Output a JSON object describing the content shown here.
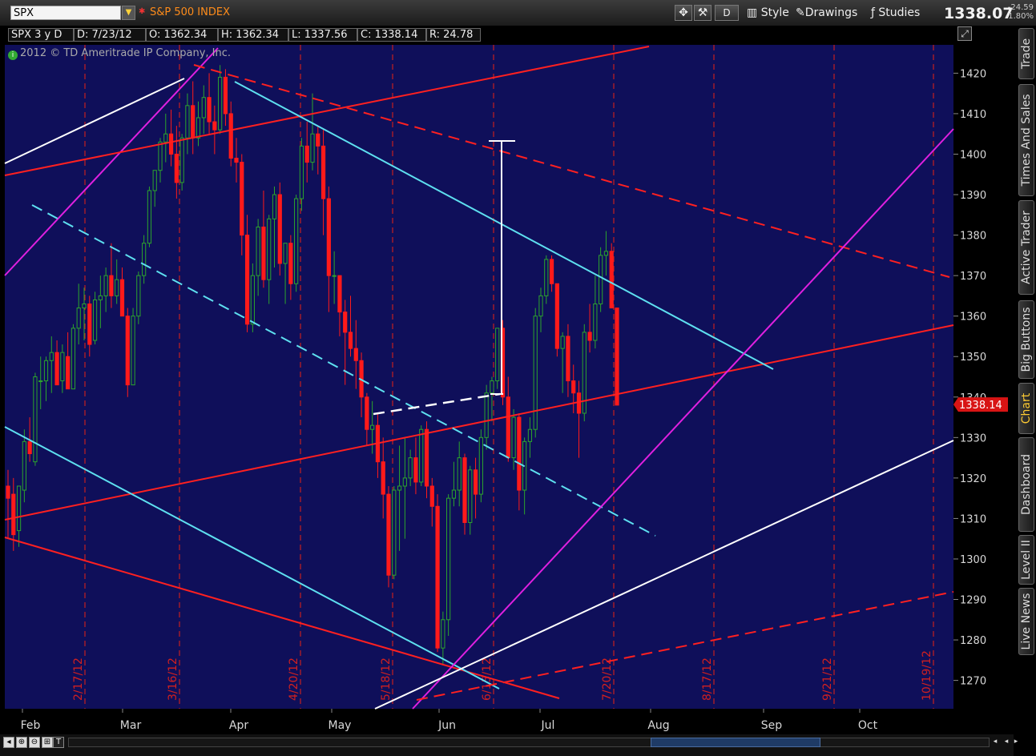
{
  "header": {
    "symbol": "SPX",
    "index_name": "S&P 500 INDEX",
    "period_button": "D",
    "style_label": "Style",
    "drawings_label": "Drawings",
    "studies_label": "Studies",
    "last_price": "1338.07",
    "net_change": "-24.59",
    "pct_change": "-1.80%"
  },
  "infobar": {
    "chart_id": "SPX 3 y D",
    "date": "D: 7/23/12",
    "open": "O: 1362.34",
    "high": "H: 1362.34",
    "low": "L: 1337.56",
    "close": "C: 1338.14",
    "range": "R: 24.78"
  },
  "copyright": "2012 © TD Ameritrade IP Company, Inc.",
  "side_tabs": [
    "Trade",
    "Times And Sales",
    "Active Trader",
    "Big Buttons",
    "Chart",
    "Dashboard",
    "Level II",
    "Live News"
  ],
  "icons": [
    "symbol-dropdown-icon",
    "crosshair-icon",
    "wrench-icon",
    "style-icon",
    "drawings-icon",
    "studies-icon",
    "resize-icon",
    "zoom-icon",
    "text-icon",
    "scroll-left-icon",
    "scroll-right-icon"
  ],
  "colors": {
    "background": "#0f0f5a",
    "up_candle": "#2ca52c",
    "down_candle": "#ff1a1a",
    "price_tag": "#d81414",
    "trendline_red": "#ff2020",
    "trendline_cyan": "#5ee0f0",
    "trendline_magenta": "#e020e0",
    "trendline_white": "#ffffff"
  },
  "chart_data": {
    "type": "candlestick",
    "title": "S&P 500 INDEX",
    "x_labels": [
      "Feb",
      "Mar",
      "Apr",
      "May",
      "Jun",
      "Jul",
      "Aug",
      "Sep",
      "Oct"
    ],
    "y_ticks": [
      1270,
      1280,
      1290,
      1300,
      1310,
      1320,
      1330,
      1340,
      1350,
      1360,
      1370,
      1380,
      1390,
      1400,
      1410,
      1420
    ],
    "ylim": [
      1263,
      1427
    ],
    "grid": false,
    "last_close_tag": "1338.14",
    "event_markers": [
      "2/17/12",
      "3/16/12",
      "4/20/12",
      "5/18/12",
      "6/15/12",
      "7/20/12",
      "8/17/12",
      "9/21/12",
      "10/19/12"
    ],
    "candles": [
      {
        "o": 1318,
        "h": 1322,
        "l": 1305,
        "c": 1315
      },
      {
        "o": 1316,
        "h": 1320,
        "l": 1302,
        "c": 1306
      },
      {
        "o": 1307,
        "h": 1318,
        "l": 1303,
        "c": 1318
      },
      {
        "o": 1317,
        "h": 1332,
        "l": 1314,
        "c": 1329
      },
      {
        "o": 1329,
        "h": 1335,
        "l": 1324,
        "c": 1326
      },
      {
        "o": 1324,
        "h": 1346,
        "l": 1323,
        "c": 1345
      },
      {
        "o": 1344,
        "h": 1350,
        "l": 1337,
        "c": 1344
      },
      {
        "o": 1344,
        "h": 1350,
        "l": 1339,
        "c": 1349
      },
      {
        "o": 1349,
        "h": 1355,
        "l": 1341,
        "c": 1351
      },
      {
        "o": 1351,
        "h": 1354,
        "l": 1343,
        "c": 1343
      },
      {
        "o": 1344,
        "h": 1353,
        "l": 1341,
        "c": 1351
      },
      {
        "o": 1350,
        "h": 1356,
        "l": 1343,
        "c": 1342
      },
      {
        "o": 1342,
        "h": 1358,
        "l": 1342,
        "c": 1357
      },
      {
        "o": 1357,
        "h": 1368,
        "l": 1353,
        "c": 1362
      },
      {
        "o": 1362,
        "h": 1367,
        "l": 1354,
        "c": 1363
      },
      {
        "o": 1363,
        "h": 1365,
        "l": 1350,
        "c": 1353
      },
      {
        "o": 1354,
        "h": 1366,
        "l": 1353,
        "c": 1364
      },
      {
        "o": 1364,
        "h": 1370,
        "l": 1357,
        "c": 1365
      },
      {
        "o": 1365,
        "h": 1372,
        "l": 1361,
        "c": 1370
      },
      {
        "o": 1370,
        "h": 1378,
        "l": 1362,
        "c": 1365
      },
      {
        "o": 1365,
        "h": 1374,
        "l": 1363,
        "c": 1369
      },
      {
        "o": 1369,
        "h": 1372,
        "l": 1360,
        "c": 1360
      },
      {
        "o": 1360,
        "h": 1362,
        "l": 1340,
        "c": 1343
      },
      {
        "o": 1343,
        "h": 1362,
        "l": 1343,
        "c": 1360
      },
      {
        "o": 1360,
        "h": 1371,
        "l": 1358,
        "c": 1370
      },
      {
        "o": 1370,
        "h": 1380,
        "l": 1368,
        "c": 1378
      },
      {
        "o": 1378,
        "h": 1392,
        "l": 1377,
        "c": 1391
      },
      {
        "o": 1391,
        "h": 1396,
        "l": 1387,
        "c": 1396
      },
      {
        "o": 1396,
        "h": 1404,
        "l": 1393,
        "c": 1403
      },
      {
        "o": 1403,
        "h": 1410,
        "l": 1398,
        "c": 1405
      },
      {
        "o": 1405,
        "h": 1411,
        "l": 1397,
        "c": 1400
      },
      {
        "o": 1400,
        "h": 1407,
        "l": 1389,
        "c": 1393
      },
      {
        "o": 1393,
        "h": 1405,
        "l": 1391,
        "c": 1404
      },
      {
        "o": 1404,
        "h": 1415,
        "l": 1400,
        "c": 1412
      },
      {
        "o": 1412,
        "h": 1418,
        "l": 1400,
        "c": 1404
      },
      {
        "o": 1404,
        "h": 1413,
        "l": 1402,
        "c": 1409
      },
      {
        "o": 1409,
        "h": 1417,
        "l": 1405,
        "c": 1414
      },
      {
        "o": 1414,
        "h": 1420,
        "l": 1405,
        "c": 1408
      },
      {
        "o": 1408,
        "h": 1412,
        "l": 1400,
        "c": 1406
      },
      {
        "o": 1406,
        "h": 1422,
        "l": 1405,
        "c": 1419
      },
      {
        "o": 1419,
        "h": 1421,
        "l": 1407,
        "c": 1410
      },
      {
        "o": 1410,
        "h": 1413,
        "l": 1397,
        "c": 1399
      },
      {
        "o": 1399,
        "h": 1404,
        "l": 1393,
        "c": 1398
      },
      {
        "o": 1398,
        "h": 1400,
        "l": 1375,
        "c": 1380
      },
      {
        "o": 1380,
        "h": 1385,
        "l": 1356,
        "c": 1358
      },
      {
        "o": 1358,
        "h": 1373,
        "l": 1356,
        "c": 1370
      },
      {
        "o": 1370,
        "h": 1384,
        "l": 1365,
        "c": 1382
      },
      {
        "o": 1382,
        "h": 1391,
        "l": 1367,
        "c": 1369
      },
      {
        "o": 1369,
        "h": 1385,
        "l": 1363,
        "c": 1384
      },
      {
        "o": 1384,
        "h": 1392,
        "l": 1372,
        "c": 1390
      },
      {
        "o": 1390,
        "h": 1393,
        "l": 1370,
        "c": 1373
      },
      {
        "o": 1373,
        "h": 1378,
        "l": 1363,
        "c": 1378
      },
      {
        "o": 1378,
        "h": 1380,
        "l": 1364,
        "c": 1368
      },
      {
        "o": 1368,
        "h": 1390,
        "l": 1366,
        "c": 1389
      },
      {
        "o": 1389,
        "h": 1404,
        "l": 1386,
        "c": 1402
      },
      {
        "o": 1402,
        "h": 1408,
        "l": 1393,
        "c": 1398
      },
      {
        "o": 1398,
        "h": 1415,
        "l": 1396,
        "c": 1405
      },
      {
        "o": 1405,
        "h": 1407,
        "l": 1395,
        "c": 1402
      },
      {
        "o": 1402,
        "h": 1406,
        "l": 1380,
        "c": 1389
      },
      {
        "o": 1389,
        "h": 1392,
        "l": 1361,
        "c": 1370
      },
      {
        "o": 1370,
        "h": 1376,
        "l": 1363,
        "c": 1370
      },
      {
        "o": 1370,
        "h": 1370,
        "l": 1355,
        "c": 1361
      },
      {
        "o": 1361,
        "h": 1364,
        "l": 1343,
        "c": 1356
      },
      {
        "o": 1356,
        "h": 1365,
        "l": 1350,
        "c": 1352
      },
      {
        "o": 1352,
        "h": 1359,
        "l": 1342,
        "c": 1349
      },
      {
        "o": 1349,
        "h": 1351,
        "l": 1335,
        "c": 1340
      },
      {
        "o": 1340,
        "h": 1341,
        "l": 1328,
        "c": 1332
      },
      {
        "o": 1332,
        "h": 1339,
        "l": 1326,
        "c": 1333
      },
      {
        "o": 1333,
        "h": 1336,
        "l": 1320,
        "c": 1324
      },
      {
        "o": 1324,
        "h": 1330,
        "l": 1310,
        "c": 1316
      },
      {
        "o": 1316,
        "h": 1318,
        "l": 1293,
        "c": 1296
      },
      {
        "o": 1296,
        "h": 1318,
        "l": 1295,
        "c": 1317
      },
      {
        "o": 1317,
        "h": 1328,
        "l": 1302,
        "c": 1318
      },
      {
        "o": 1318,
        "h": 1330,
        "l": 1305,
        "c": 1320
      },
      {
        "o": 1320,
        "h": 1327,
        "l": 1318,
        "c": 1325
      },
      {
        "o": 1325,
        "h": 1330,
        "l": 1316,
        "c": 1319
      },
      {
        "o": 1319,
        "h": 1333,
        "l": 1318,
        "c": 1332
      },
      {
        "o": 1332,
        "h": 1334,
        "l": 1315,
        "c": 1318
      },
      {
        "o": 1318,
        "h": 1320,
        "l": 1308,
        "c": 1313
      },
      {
        "o": 1313,
        "h": 1316,
        "l": 1277,
        "c": 1278
      },
      {
        "o": 1278,
        "h": 1287,
        "l": 1274,
        "c": 1285
      },
      {
        "o": 1285,
        "h": 1316,
        "l": 1281,
        "c": 1315
      },
      {
        "o": 1315,
        "h": 1324,
        "l": 1313,
        "c": 1317
      },
      {
        "o": 1317,
        "h": 1329,
        "l": 1313,
        "c": 1325
      },
      {
        "o": 1325,
        "h": 1326,
        "l": 1306,
        "c": 1309
      },
      {
        "o": 1309,
        "h": 1323,
        "l": 1306,
        "c": 1322
      },
      {
        "o": 1322,
        "h": 1325,
        "l": 1310,
        "c": 1316
      },
      {
        "o": 1316,
        "h": 1332,
        "l": 1314,
        "c": 1330
      },
      {
        "o": 1330,
        "h": 1343,
        "l": 1327,
        "c": 1341
      },
      {
        "o": 1341,
        "h": 1345,
        "l": 1334,
        "c": 1344
      },
      {
        "o": 1344,
        "h": 1357,
        "l": 1342,
        "c": 1357
      },
      {
        "o": 1357,
        "h": 1359,
        "l": 1338,
        "c": 1340
      },
      {
        "o": 1340,
        "h": 1345,
        "l": 1324,
        "c": 1325
      },
      {
        "o": 1325,
        "h": 1337,
        "l": 1322,
        "c": 1335
      },
      {
        "o": 1335,
        "h": 1336,
        "l": 1312,
        "c": 1317
      },
      {
        "o": 1317,
        "h": 1330,
        "l": 1311,
        "c": 1329
      },
      {
        "o": 1329,
        "h": 1335,
        "l": 1325,
        "c": 1332
      },
      {
        "o": 1332,
        "h": 1362,
        "l": 1330,
        "c": 1360
      },
      {
        "o": 1360,
        "h": 1367,
        "l": 1356,
        "c": 1365
      },
      {
        "o": 1365,
        "h": 1375,
        "l": 1363,
        "c": 1374
      },
      {
        "o": 1374,
        "h": 1375,
        "l": 1366,
        "c": 1368
      },
      {
        "o": 1368,
        "h": 1368,
        "l": 1350,
        "c": 1352
      },
      {
        "o": 1352,
        "h": 1356,
        "l": 1341,
        "c": 1355
      },
      {
        "o": 1355,
        "h": 1358,
        "l": 1340,
        "c": 1344
      },
      {
        "o": 1344,
        "h": 1348,
        "l": 1336,
        "c": 1341
      },
      {
        "o": 1341,
        "h": 1344,
        "l": 1325,
        "c": 1336
      },
      {
        "o": 1336,
        "h": 1358,
        "l": 1334,
        "c": 1356
      },
      {
        "o": 1356,
        "h": 1363,
        "l": 1351,
        "c": 1354
      },
      {
        "o": 1354,
        "h": 1370,
        "l": 1352,
        "c": 1363
      },
      {
        "o": 1363,
        "h": 1377,
        "l": 1361,
        "c": 1375
      },
      {
        "o": 1375,
        "h": 1381,
        "l": 1370,
        "c": 1376
      },
      {
        "o": 1376,
        "h": 1378,
        "l": 1362,
        "c": 1362
      },
      {
        "o": 1362,
        "h": 1362,
        "l": 1338,
        "c": 1338
      }
    ]
  }
}
